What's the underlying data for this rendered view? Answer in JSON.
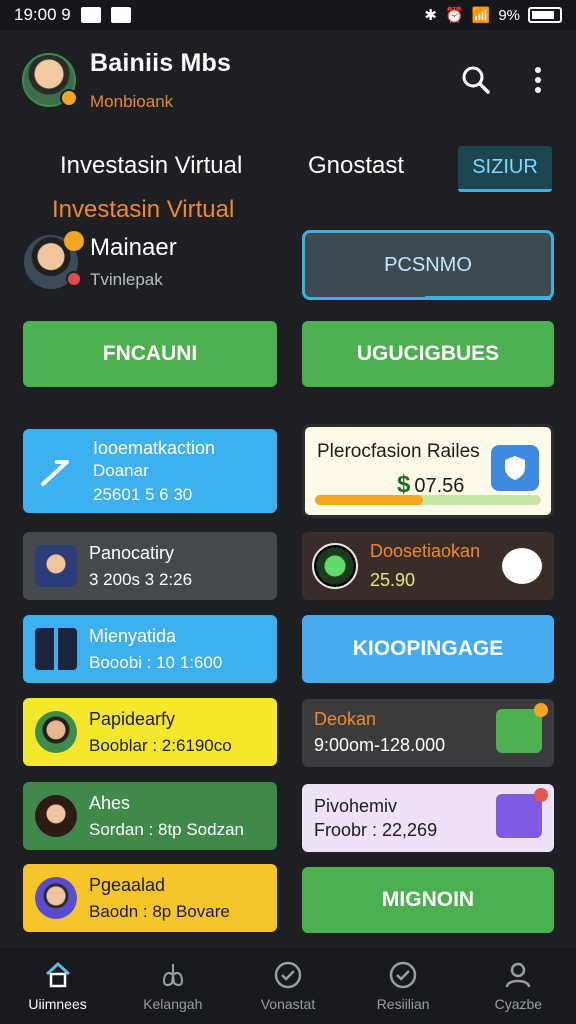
{
  "status_bar": {
    "time": "19:00 9",
    "battery_pct": "9%"
  },
  "header": {
    "title": "Bainiis Mbs",
    "subtitle": "Monbioank"
  },
  "tabs": [
    {
      "label": "Investasin Virtual"
    },
    {
      "label": "Gnostast"
    },
    {
      "label": "SIZIUR",
      "active": true
    }
  ],
  "section_title": "Investasin Virtual",
  "manager": {
    "name": "Mainaer",
    "role": "Tvinlepak"
  },
  "promo_button": "PCSNMO",
  "action_buttons": {
    "left": "FNCAUNI",
    "right": "UGUCIGBUES"
  },
  "left_cards": [
    {
      "title": "Iooematkaction",
      "subtitle": "Doanar",
      "value": "25601 5 6 30",
      "color": "blue"
    },
    {
      "title": "Panocatiry",
      "value": "3 200s  3 2:26",
      "color": "dark"
    },
    {
      "title": "Mienyatida",
      "value": "Booobi : 10 1:600",
      "color": "blue"
    },
    {
      "title": "Papidearfy",
      "value": "Booblar : 2:6190co",
      "color": "yellow"
    },
    {
      "title": "Ahes",
      "value": "Sordan : 8tp Sodzan",
      "color": "green"
    },
    {
      "title": "Pgeaalad",
      "value": "Baodn : 8p Bovare",
      "color": "orange"
    }
  ],
  "right_cards": {
    "protection": {
      "title": "Plerocfasion Railes",
      "value": "07.56",
      "progress": 0.48
    },
    "development": {
      "title": "Doosetiaokan",
      "value": "25.90"
    },
    "kiosk": "KIOOPINGAGE",
    "roca": {
      "title": "Deokan",
      "value": "9:00om-128.000"
    },
    "privo": {
      "title": "Pivohemiv",
      "value": "Froobr : 22,269"
    },
    "mignon": "MIGNOIN"
  },
  "bottom_nav": [
    {
      "label": "Uiimnees",
      "icon": "home-icon",
      "active": true
    },
    {
      "label": "Kelangah",
      "icon": "lungs-icon"
    },
    {
      "label": "Vonastat",
      "icon": "check-circle-icon"
    },
    {
      "label": "Resiilian",
      "icon": "check-circle-icon"
    },
    {
      "label": "Cyazbe",
      "icon": "person-icon"
    }
  ]
}
